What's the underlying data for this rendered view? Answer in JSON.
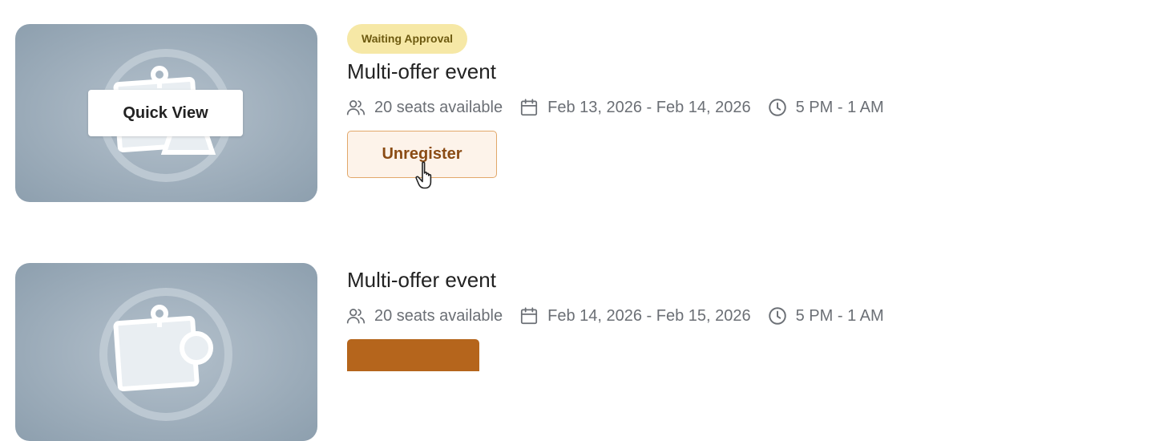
{
  "events": [
    {
      "status": "Waiting Approval",
      "title": "Multi-offer event",
      "quick_view_label": "Quick View",
      "seats": "20 seats available",
      "dates": "Feb 13, 2026 - Feb 14, 2026",
      "time": "5 PM - 1 AM",
      "action_label": "Unregister"
    },
    {
      "title": "Multi-offer event",
      "seats": "20 seats available",
      "dates": "Feb 14, 2026 - Feb 15, 2026",
      "time": "5 PM - 1 AM",
      "action_label": ""
    }
  ],
  "icons": {
    "seats": "users-icon",
    "dates": "calendar-icon",
    "time": "clock-icon",
    "thumbnail": "event-placeholder-icon",
    "cursor": "hand-pointer-icon"
  },
  "colors": {
    "badge_bg": "#f6e8a6",
    "badge_text": "#6d5a10",
    "unregister_border": "#e2a86a",
    "unregister_bg": "#fdf3ea",
    "unregister_text": "#8a4b14",
    "primary_button": "#b5651c",
    "meta_text": "#6b6f75"
  }
}
